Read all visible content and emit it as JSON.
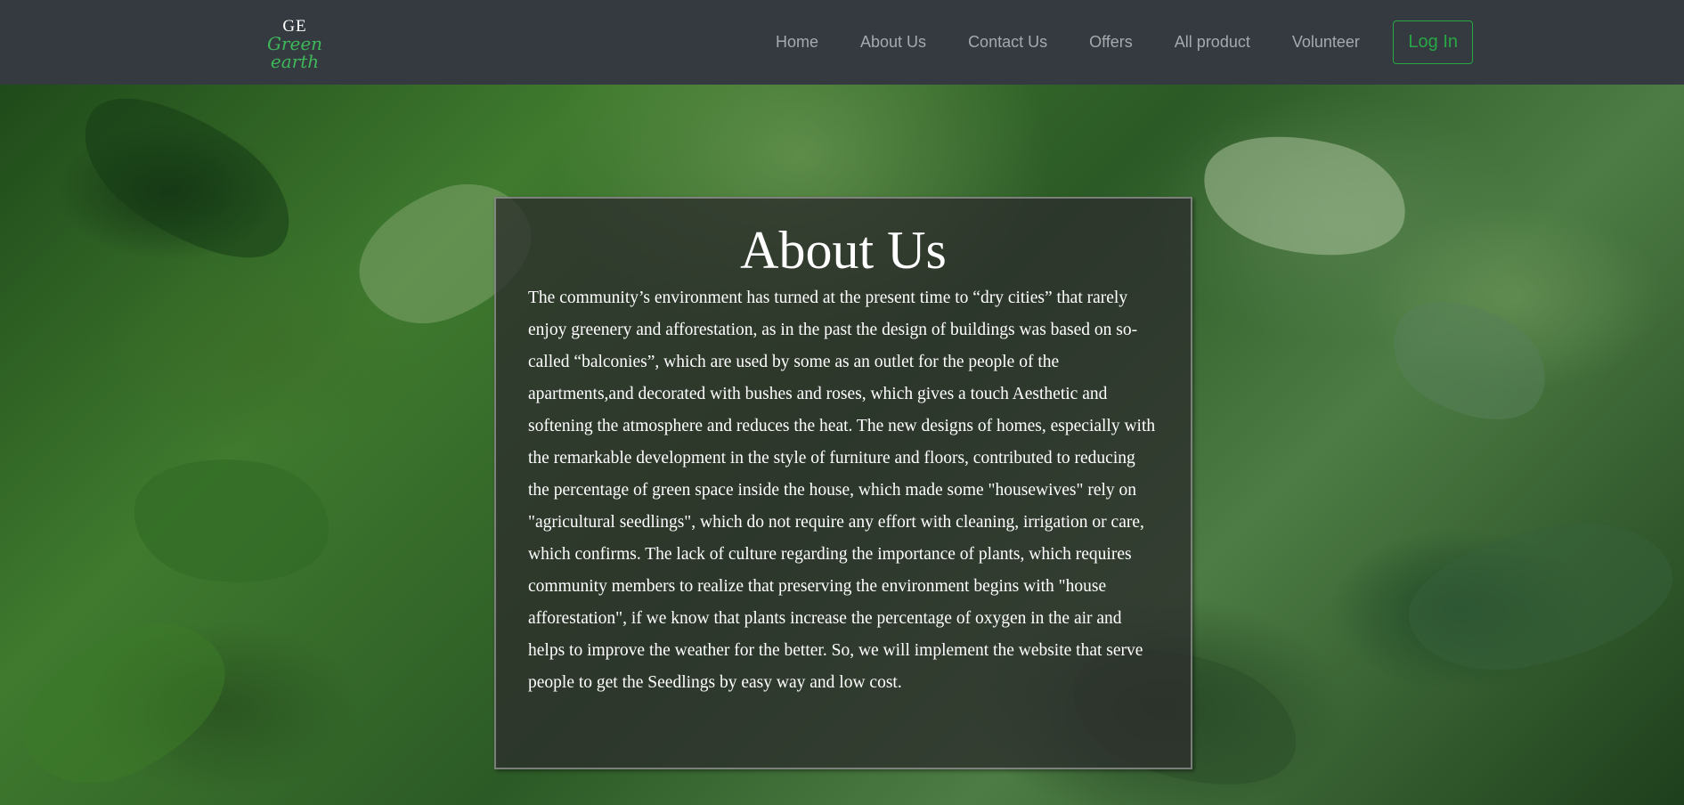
{
  "brand": {
    "initials": "GE",
    "name": "Green earth",
    "accent_color": "#3fb85a"
  },
  "nav": {
    "links": [
      "Home",
      "About Us",
      "Contact Us",
      "Offers",
      "All product",
      "Volunteer"
    ],
    "login_label": "Log In",
    "background_color": "#343a40",
    "link_color": "#a6a9ad",
    "login_color": "#28a745"
  },
  "hero": {
    "background": "green-leaves-photo"
  },
  "about": {
    "title": "About Us",
    "body": "The community’s environment has turned at the present time to “dry cities” that rarely enjoy greenery and afforestation, as in the past the design of buildings was based on so-called “balconies”, which are used by some as an outlet for the people of the apartments,and decorated with bushes and roses, which gives a touch Aesthetic and softening the atmosphere and reduces the heat. The new designs of homes, especially with the remarkable development in the style of furniture and floors, contributed to reducing the percentage of green space inside the house, which made some \"housewives\" rely on \"agricultural seedlings\", which do not require any effort with cleaning, irrigation or care, which confirms. The lack of culture regarding the importance of plants, which requires community members to realize that preserving the environment begins with \"house afforestation\", if we know that plants increase the percentage of oxygen in the air and helps to improve the weather for the better. So, we will implement the website that serve people to get the Seedlings by easy way and low cost."
  }
}
